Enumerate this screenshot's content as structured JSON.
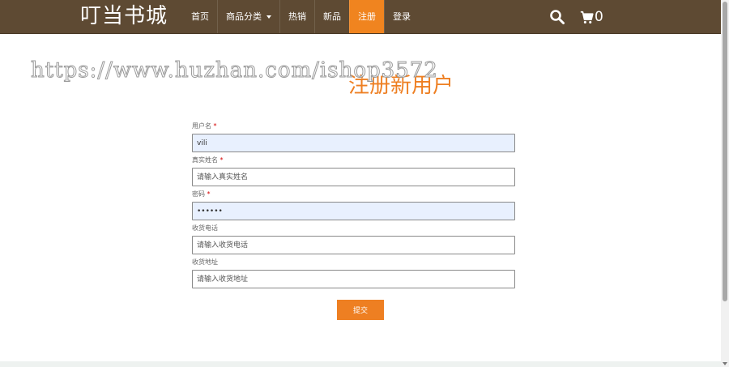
{
  "header": {
    "brand": "叮当书城",
    "nav": [
      {
        "label": "首页",
        "active": false
      },
      {
        "label": "商品分类",
        "active": false,
        "dropdown": true
      },
      {
        "label": "热销",
        "active": false
      },
      {
        "label": "新品",
        "active": false
      },
      {
        "label": "注册",
        "active": true
      },
      {
        "label": "登录",
        "active": false
      }
    ],
    "search_icon": "search-icon",
    "cart_icon": "cart-icon",
    "cart_count": "0"
  },
  "watermark": "https://www.huzhan.com/ishop3572",
  "page_title": "注册新用户",
  "form": {
    "username": {
      "label": "用户名",
      "required": "*",
      "value": "vili",
      "placeholder": ""
    },
    "realname": {
      "label": "真实姓名",
      "required": "*",
      "value": "",
      "placeholder": "请输入真实姓名"
    },
    "password": {
      "label": "密码",
      "required": "*",
      "value": "••••••",
      "placeholder": ""
    },
    "phone": {
      "label": "收货电话",
      "value": "",
      "placeholder": "请输入收货电话"
    },
    "address": {
      "label": "收货地址",
      "value": "",
      "placeholder": "请输入收货地址"
    },
    "submit_label": "提交"
  },
  "colors": {
    "header_bg": "#5e4a33",
    "accent": "#ee7f22",
    "active_nav": "#f0841f",
    "autofill_bg": "#e8f0fe"
  }
}
